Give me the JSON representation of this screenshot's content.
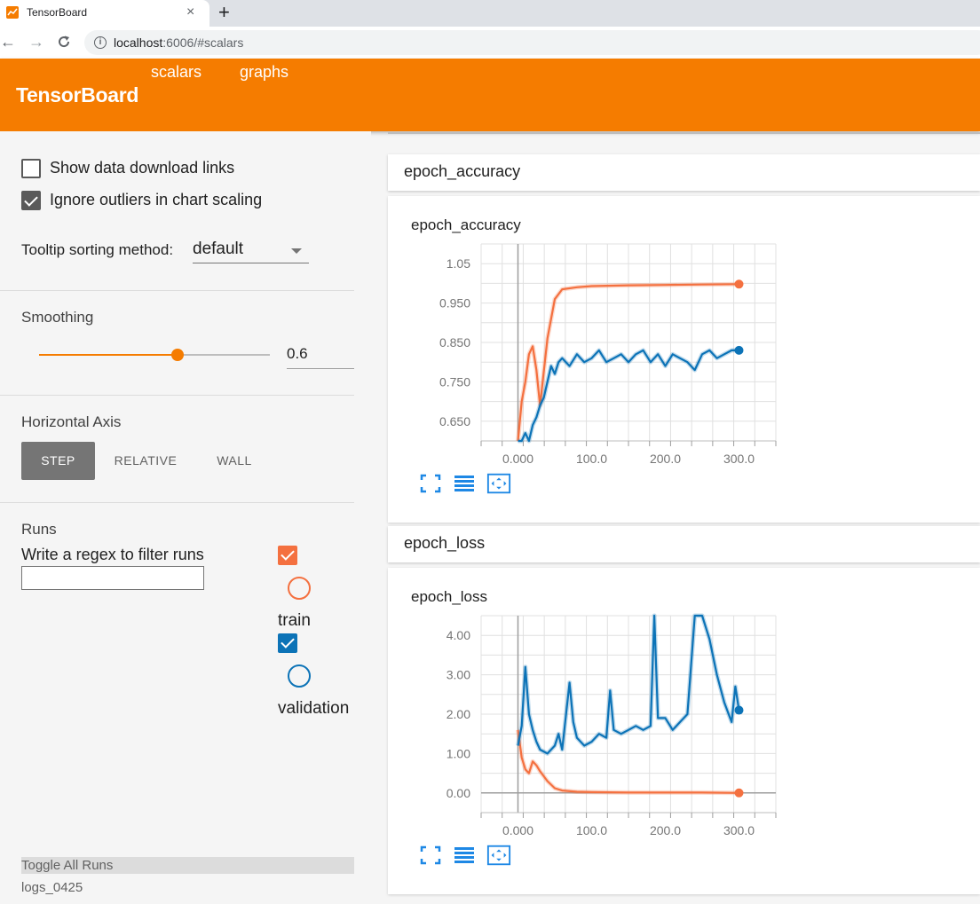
{
  "browser": {
    "tab_title": "TensorBoard",
    "tab_close": "×",
    "new_tab": "+",
    "back": "←",
    "forward": "→",
    "reload": "C",
    "url_host": "localhost",
    "url_rest": ":6006/#scalars"
  },
  "header": {
    "title": "TensorBoard",
    "tabs": [
      "scalars",
      "graphs"
    ],
    "accent": "#f57c00"
  },
  "sidebar": {
    "show_download_label": "Show data download links",
    "show_download_checked": false,
    "ignore_outliers_label": "Ignore outliers in chart scaling",
    "ignore_outliers_checked": true,
    "tooltip_label": "Tooltip sorting method:",
    "tooltip_value": "default",
    "smoothing_title": "Smoothing",
    "smoothing_value": "0.6",
    "smoothing_fraction": 0.6,
    "axis_title": "Horizontal Axis",
    "axis_options": [
      "STEP",
      "RELATIVE",
      "WALL"
    ],
    "axis_selected": "STEP",
    "runs_title": "Runs",
    "regex_label": "Write a regex to filter runs",
    "runs": [
      {
        "name": "train",
        "color": "#f4703f",
        "checked": true
      },
      {
        "name": "validation",
        "color": "#0c73b7",
        "checked": true
      }
    ],
    "toggle_all": "Toggle All Runs",
    "log_dir": "logs_0425"
  },
  "main": {
    "categories": [
      {
        "title": "epoch_accuracy"
      },
      {
        "title": "epoch_loss"
      }
    ]
  },
  "chart_data": [
    {
      "type": "line",
      "title": "epoch_accuracy",
      "xlabel": "",
      "ylabel": "",
      "xlim": [
        -50,
        350
      ],
      "ylim": [
        0.6,
        1.1
      ],
      "x_ticks": [
        "0.000",
        "100.0",
        "200.0",
        "300.0"
      ],
      "y_ticks": [
        "0.650",
        "0.750",
        "0.850",
        "0.950",
        "1.05"
      ],
      "grid": true,
      "series": [
        {
          "name": "train",
          "color": "#f4703f",
          "x": [
            0,
            5,
            10,
            15,
            20,
            25,
            30,
            40,
            50,
            60,
            80,
            100,
            150,
            200,
            250,
            300
          ],
          "values": [
            0.6,
            0.7,
            0.75,
            0.82,
            0.84,
            0.78,
            0.69,
            0.86,
            0.96,
            0.985,
            0.99,
            0.993,
            0.995,
            0.996,
            0.997,
            0.998
          ]
        },
        {
          "name": "validation",
          "color": "#0c73b7",
          "x": [
            0,
            5,
            10,
            15,
            20,
            25,
            30,
            35,
            40,
            45,
            50,
            55,
            60,
            70,
            80,
            90,
            100,
            110,
            120,
            130,
            140,
            150,
            160,
            170,
            180,
            190,
            200,
            210,
            220,
            230,
            240,
            250,
            260,
            270,
            280,
            290,
            300
          ],
          "values": [
            0.6,
            0.6,
            0.62,
            0.6,
            0.64,
            0.66,
            0.69,
            0.71,
            0.75,
            0.79,
            0.77,
            0.8,
            0.81,
            0.79,
            0.82,
            0.8,
            0.81,
            0.83,
            0.8,
            0.81,
            0.82,
            0.8,
            0.82,
            0.83,
            0.8,
            0.82,
            0.79,
            0.82,
            0.81,
            0.8,
            0.78,
            0.82,
            0.83,
            0.81,
            0.82,
            0.83,
            0.83
          ]
        }
      ]
    },
    {
      "type": "line",
      "title": "epoch_loss",
      "xlabel": "",
      "ylabel": "",
      "xlim": [
        -50,
        350
      ],
      "ylim": [
        -0.5,
        4.5
      ],
      "x_ticks": [
        "0.000",
        "100.0",
        "200.0",
        "300.0"
      ],
      "y_ticks": [
        "0.00",
        "1.00",
        "2.00",
        "3.00",
        "4.00"
      ],
      "grid": true,
      "series": [
        {
          "name": "train",
          "color": "#f4703f",
          "x": [
            0,
            5,
            10,
            15,
            20,
            25,
            30,
            40,
            50,
            60,
            80,
            100,
            150,
            200,
            250,
            300
          ],
          "values": [
            1.6,
            0.9,
            0.6,
            0.5,
            0.8,
            0.7,
            0.55,
            0.3,
            0.12,
            0.06,
            0.03,
            0.02,
            0.01,
            0.01,
            0.01,
            0.0
          ]
        },
        {
          "name": "validation",
          "color": "#0c73b7",
          "x": [
            0,
            5,
            10,
            15,
            20,
            25,
            30,
            40,
            50,
            55,
            60,
            70,
            75,
            80,
            90,
            100,
            110,
            120,
            125,
            130,
            140,
            150,
            160,
            170,
            180,
            185,
            190,
            200,
            210,
            220,
            230,
            240,
            250,
            260,
            270,
            280,
            290,
            295,
            300
          ],
          "values": [
            1.2,
            1.7,
            3.2,
            2.0,
            1.6,
            1.3,
            1.1,
            1.0,
            1.2,
            1.5,
            1.1,
            2.8,
            1.8,
            1.4,
            1.2,
            1.3,
            1.5,
            1.4,
            2.6,
            1.6,
            1.5,
            1.6,
            1.7,
            1.6,
            1.7,
            4.5,
            1.9,
            1.9,
            1.6,
            1.8,
            2.0,
            4.5,
            4.5,
            3.9,
            3.0,
            2.3,
            1.8,
            2.7,
            2.1
          ]
        }
      ]
    }
  ]
}
